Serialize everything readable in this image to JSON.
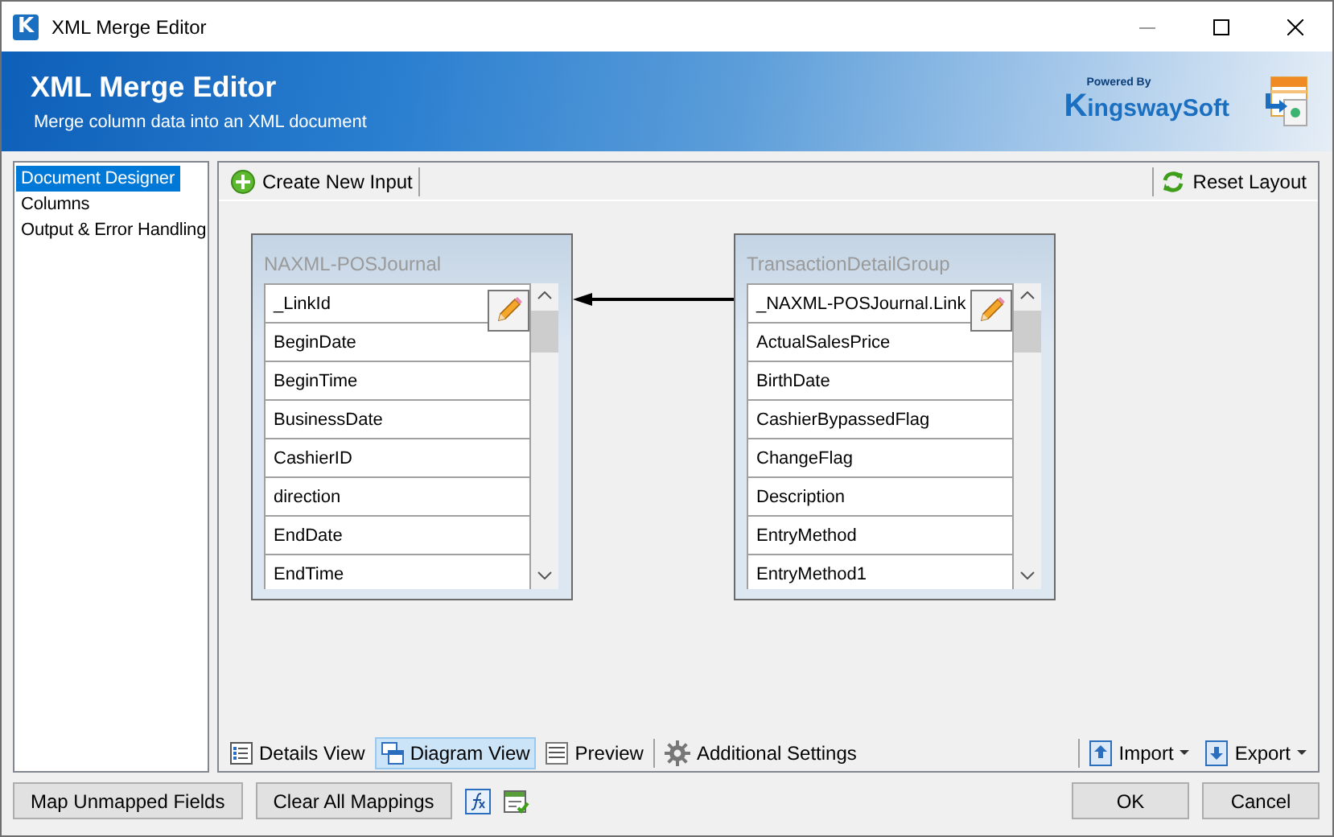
{
  "window": {
    "title": "XML Merge Editor",
    "app_icon_letter": "K"
  },
  "banner": {
    "title": "XML Merge Editor",
    "subtitle": "Merge column data into an XML document",
    "logo_tagline": "Powered By",
    "logo_brand": "KingswaySoft"
  },
  "sidebar": {
    "items": [
      {
        "label": "Document Designer",
        "selected": true
      },
      {
        "label": "Columns",
        "selected": false
      },
      {
        "label": "Output & Error Handling",
        "selected": false
      }
    ]
  },
  "toolbar": {
    "left": "Create New Input",
    "right": "Reset Layout"
  },
  "diagram": {
    "nodes": [
      {
        "title": "NAXML-POSJournal",
        "rows": [
          "_LinkId",
          "BeginDate",
          "BeginTime",
          "BusinessDate",
          "CashierID",
          "direction",
          "EndDate",
          "EndTime"
        ]
      },
      {
        "title": "TransactionDetailGroup",
        "rows": [
          "_NAXML-POSJournal.Link",
          "ActualSalesPrice",
          "BirthDate",
          "CashierBypassedFlag",
          "ChangeFlag",
          "Description",
          "EntryMethod",
          "EntryMethod1"
        ]
      }
    ]
  },
  "view_tabs": [
    {
      "label": "Details View",
      "kind": "details",
      "selected": false
    },
    {
      "label": "Diagram View",
      "kind": "diagram",
      "selected": true
    },
    {
      "label": "Preview",
      "kind": "preview",
      "selected": false
    },
    {
      "label": "Additional Settings",
      "kind": "settings",
      "selected": false
    }
  ],
  "menus": [
    {
      "label": "Import",
      "kind": "import"
    },
    {
      "label": "Export",
      "kind": "export"
    }
  ],
  "footer": {
    "left_buttons": [
      "Map Unmapped Fields",
      "Clear All Mappings"
    ],
    "right_buttons": [
      "OK",
      "Cancel"
    ]
  }
}
